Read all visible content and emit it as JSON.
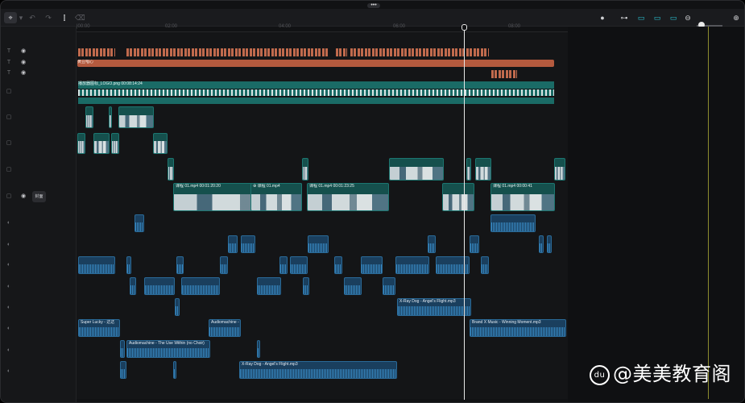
{
  "toolbar": {
    "pointer_icon": "arrow-pointer-icon",
    "undo_icon": "undo-icon",
    "redo_icon": "redo-icon",
    "split_icon": "split-icon",
    "delete_icon": "delete-icon",
    "mic_icon": "microphone-icon",
    "link_icon": "link-icon",
    "snap_icon": "snap-icon",
    "preview_icon": "preview-icon",
    "magnet_icon": "magnet-icon",
    "zoom_out_icon": "zoom-out-icon",
    "zoom_in_icon": "zoom-in-icon"
  },
  "ruler": {
    "ticks": [
      "|00:00",
      "02:00",
      "04:00",
      "06:00",
      "08:00"
    ]
  },
  "sidebar": {
    "track_names": [
      "text",
      "text",
      "text",
      "sticker",
      "video-3",
      "video-2",
      "video-1",
      "main",
      "audio-1",
      "audio-2",
      "audio-3",
      "audio-4",
      "audio-5",
      "audio-6",
      "audio-7",
      "audio-8"
    ],
    "main_chip": "封面"
  },
  "tracks": {
    "subtitle_clip": "黄豆唱心",
    "sticker_clip": "播放器图标_LOGO.png  00:08:14:24",
    "main_clips": [
      {
        "label": "课程 01.mp4   00:01:20:20"
      },
      {
        "label": "⊕ 课程 01.mp4"
      },
      {
        "label": "课程 01.mp4   00:01:23:25"
      },
      {
        "label": "课程 01.mp4   00:00:41"
      }
    ],
    "audio_clips": {
      "angel1": "X-Ray Dog - Angel's Flight.mp3",
      "super_lucky": "Super Lucky - 达达",
      "audiomachine1": "Audiomachine - ",
      "brand_x": "Brand X Music - Winning Moment.mp3",
      "audiomachine2": "Audiomachine - The Use Within (no Choir)",
      "angel2": "X-Ray Dog - Angel's Flight.mp3"
    }
  },
  "watermark": {
    "logo": "du",
    "text": "@美美教育阁"
  },
  "colors": {
    "video_clip": "#15504d",
    "audio_clip": "#1a3f5e",
    "subtitle_clip": "#b45a3e",
    "playhead": "#e8e8e8",
    "accent": "#2ac7d8"
  }
}
